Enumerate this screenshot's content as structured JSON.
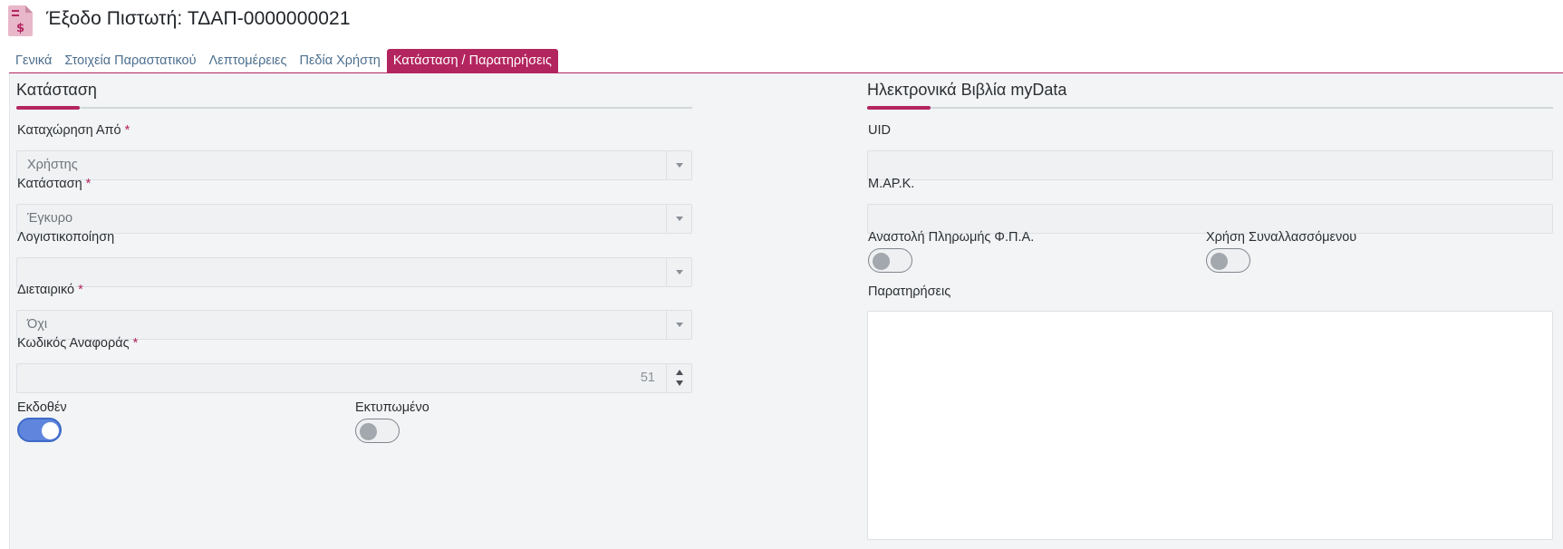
{
  "header": {
    "title": "Έξοδο Πιστωτή: ΤΔΑΠ-0000000021",
    "icon": "invoice-dollar-icon",
    "icon_color": "#b3255f"
  },
  "tabs": [
    {
      "label": "Γενικά",
      "active": false
    },
    {
      "label": "Στοιχεία Παραστατικού",
      "active": false
    },
    {
      "label": "Λεπτομέρειες",
      "active": false
    },
    {
      "label": "Πεδία Χρήστη",
      "active": false
    },
    {
      "label": "Κατάσταση / Παρατηρήσεις",
      "active": true
    }
  ],
  "status_section": {
    "title": "Κατάσταση",
    "entry_by": {
      "label": "Καταχώρηση Από",
      "required": "*",
      "value": "Χρήστης"
    },
    "status": {
      "label": "Κατάσταση",
      "required": "*",
      "value": "Έγκυρο"
    },
    "accounting": {
      "label": "Λογιστικοποίηση",
      "value": ""
    },
    "intercompany": {
      "label": "Διεταιρικό",
      "required": "*",
      "value": "Όχι"
    },
    "reference_code": {
      "label": "Κωδικός Αναφοράς",
      "required": "*",
      "value": "51"
    },
    "issued": {
      "label": "Εκδοθέν",
      "checked": true
    },
    "printed": {
      "label": "Εκτυπωμένο",
      "checked": false
    }
  },
  "mydata_section": {
    "title": "Ηλεκτρονικά Βιβλία myData",
    "uid": {
      "label": "UID",
      "value": ""
    },
    "mark": {
      "label": "Μ.ΑΡ.Κ.",
      "value": ""
    },
    "vat_suspension": {
      "label": "Αναστολή Πληρωμής Φ.Π.Α.",
      "checked": false
    },
    "counterparty_use": {
      "label": "Χρήση Συναλλασσόμενου",
      "checked": false
    },
    "notes": {
      "label": "Παρατηρήσεις",
      "value": ""
    }
  },
  "colors": {
    "accent": "#b3255f",
    "toggle_on": "#5f86dc",
    "link": "#4d6f8f"
  }
}
